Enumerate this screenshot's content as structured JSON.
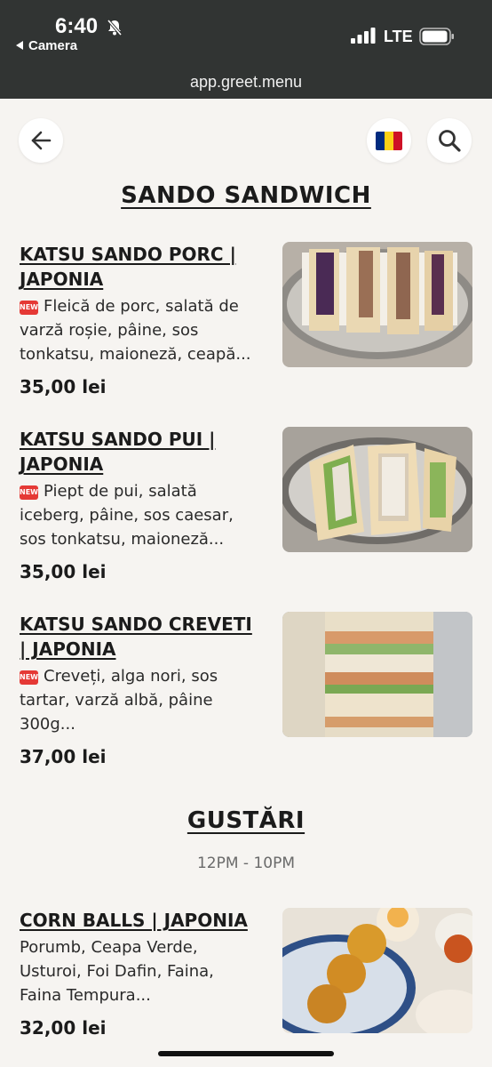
{
  "status_bar": {
    "time": "6:40",
    "back_app_label": "Camera",
    "network": "LTE"
  },
  "browser": {
    "url": "app.greet.menu"
  },
  "header": {
    "back_icon": "arrow-left-icon",
    "language_flag": "romania-flag",
    "flag_colors": [
      "#002B7F",
      "#FCD116",
      "#CE1126"
    ],
    "search_icon": "search-icon"
  },
  "sections": [
    {
      "title": "SANDO SANDWICH",
      "items": [
        {
          "name_line1": "KATSU SANDO PORC |",
          "name_line2": "JAPONIA",
          "badge": "NEW",
          "desc_line1": "Fleică de porc, salată de",
          "desc_line2": "varză roșie, pâine, sos",
          "desc_line3": "tonkatsu, maioneză, ceapă...",
          "price": "35,00 lei"
        },
        {
          "name_line1": "KATSU SANDO PUI |",
          "name_line2": "JAPONIA",
          "badge": "NEW",
          "desc_line1": "Piept de pui, salată",
          "desc_line2": "iceberg, pâine, sos caesar,",
          "desc_line3": "sos tonkatsu, maioneză...",
          "price": "35,00 lei"
        },
        {
          "name_line1": "KATSU SANDO CREVETI",
          "name_line2": "| JAPONIA",
          "badge": "NEW",
          "desc_line1": "Creveți, alga nori, sos",
          "desc_line2": "tartar, varză albă, pâine",
          "desc_line3": "300g...",
          "price": "37,00 lei"
        }
      ]
    },
    {
      "title": "GUSTĂRI",
      "hours": "12PM - 10PM",
      "items": [
        {
          "name_line1": "CORN BALLS | JAPONIA",
          "desc_line1": "Porumb, Ceapa Verde,",
          "desc_line2": "Usturoi, Foi Dafin, Faina,",
          "desc_line3": "Faina Tempura...",
          "price": "32,00 lei"
        }
      ]
    }
  ]
}
